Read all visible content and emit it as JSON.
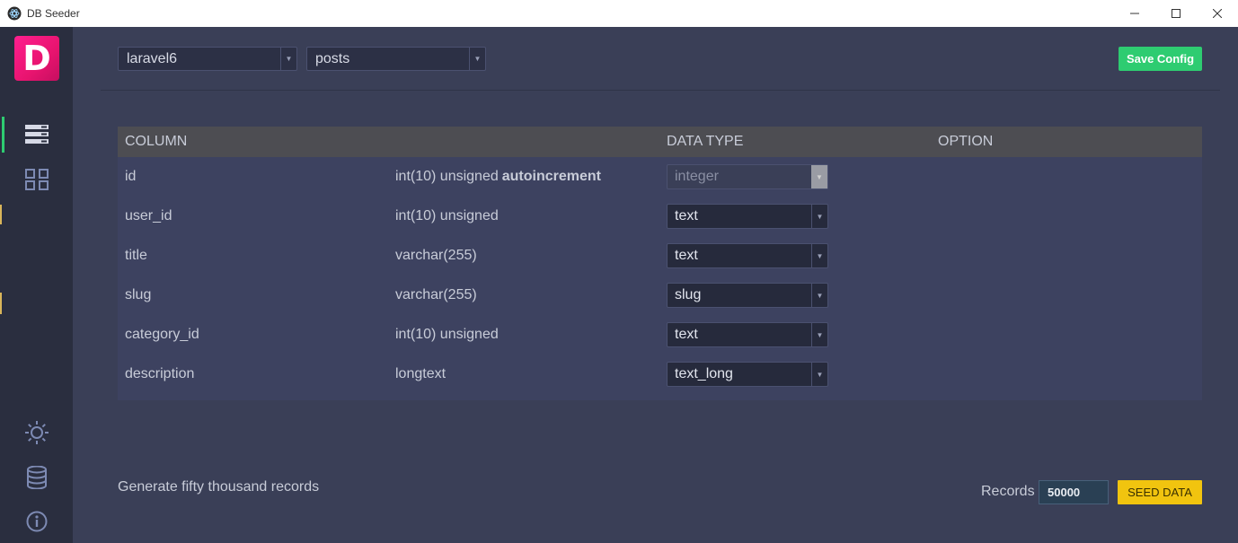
{
  "window": {
    "title": "DB Seeder"
  },
  "sidebar": {
    "logo_letter": "D",
    "items": [
      {
        "icon": "tables-icon",
        "active": true
      },
      {
        "icon": "grid-icon",
        "active": false
      }
    ],
    "bottom_items": [
      {
        "icon": "sun-icon"
      },
      {
        "icon": "database-icon"
      },
      {
        "icon": "info-icon"
      }
    ]
  },
  "toolbar": {
    "database_select": "laravel6",
    "table_select": "posts",
    "save_label": "Save Config"
  },
  "table": {
    "headers": {
      "column": "COLUMN",
      "definition": "",
      "data_type": "DATA TYPE",
      "option": "OPTION"
    },
    "rows": [
      {
        "column": "id",
        "definition": "int(10) unsigned",
        "extra": "autoincrement",
        "data_type": "integer",
        "disabled": true
      },
      {
        "column": "user_id",
        "definition": "int(10) unsigned",
        "extra": "",
        "data_type": "text",
        "disabled": false
      },
      {
        "column": "title",
        "definition": "varchar(255)",
        "extra": "",
        "data_type": "text",
        "disabled": false
      },
      {
        "column": "slug",
        "definition": "varchar(255)",
        "extra": "",
        "data_type": "slug",
        "disabled": false
      },
      {
        "column": "category_id",
        "definition": "int(10) unsigned",
        "extra": "",
        "data_type": "text",
        "disabled": false
      },
      {
        "column": "description",
        "definition": "longtext",
        "extra": "",
        "data_type": "text_long",
        "disabled": false
      }
    ]
  },
  "footer": {
    "summary": "Generate fifty thousand records",
    "records_label": "Records",
    "records_value": "50000",
    "seed_label": "SEED DATA"
  },
  "colors": {
    "accent_green": "#2ecc71",
    "accent_yellow": "#f1c40f",
    "logo_pink": "#e8146f"
  }
}
